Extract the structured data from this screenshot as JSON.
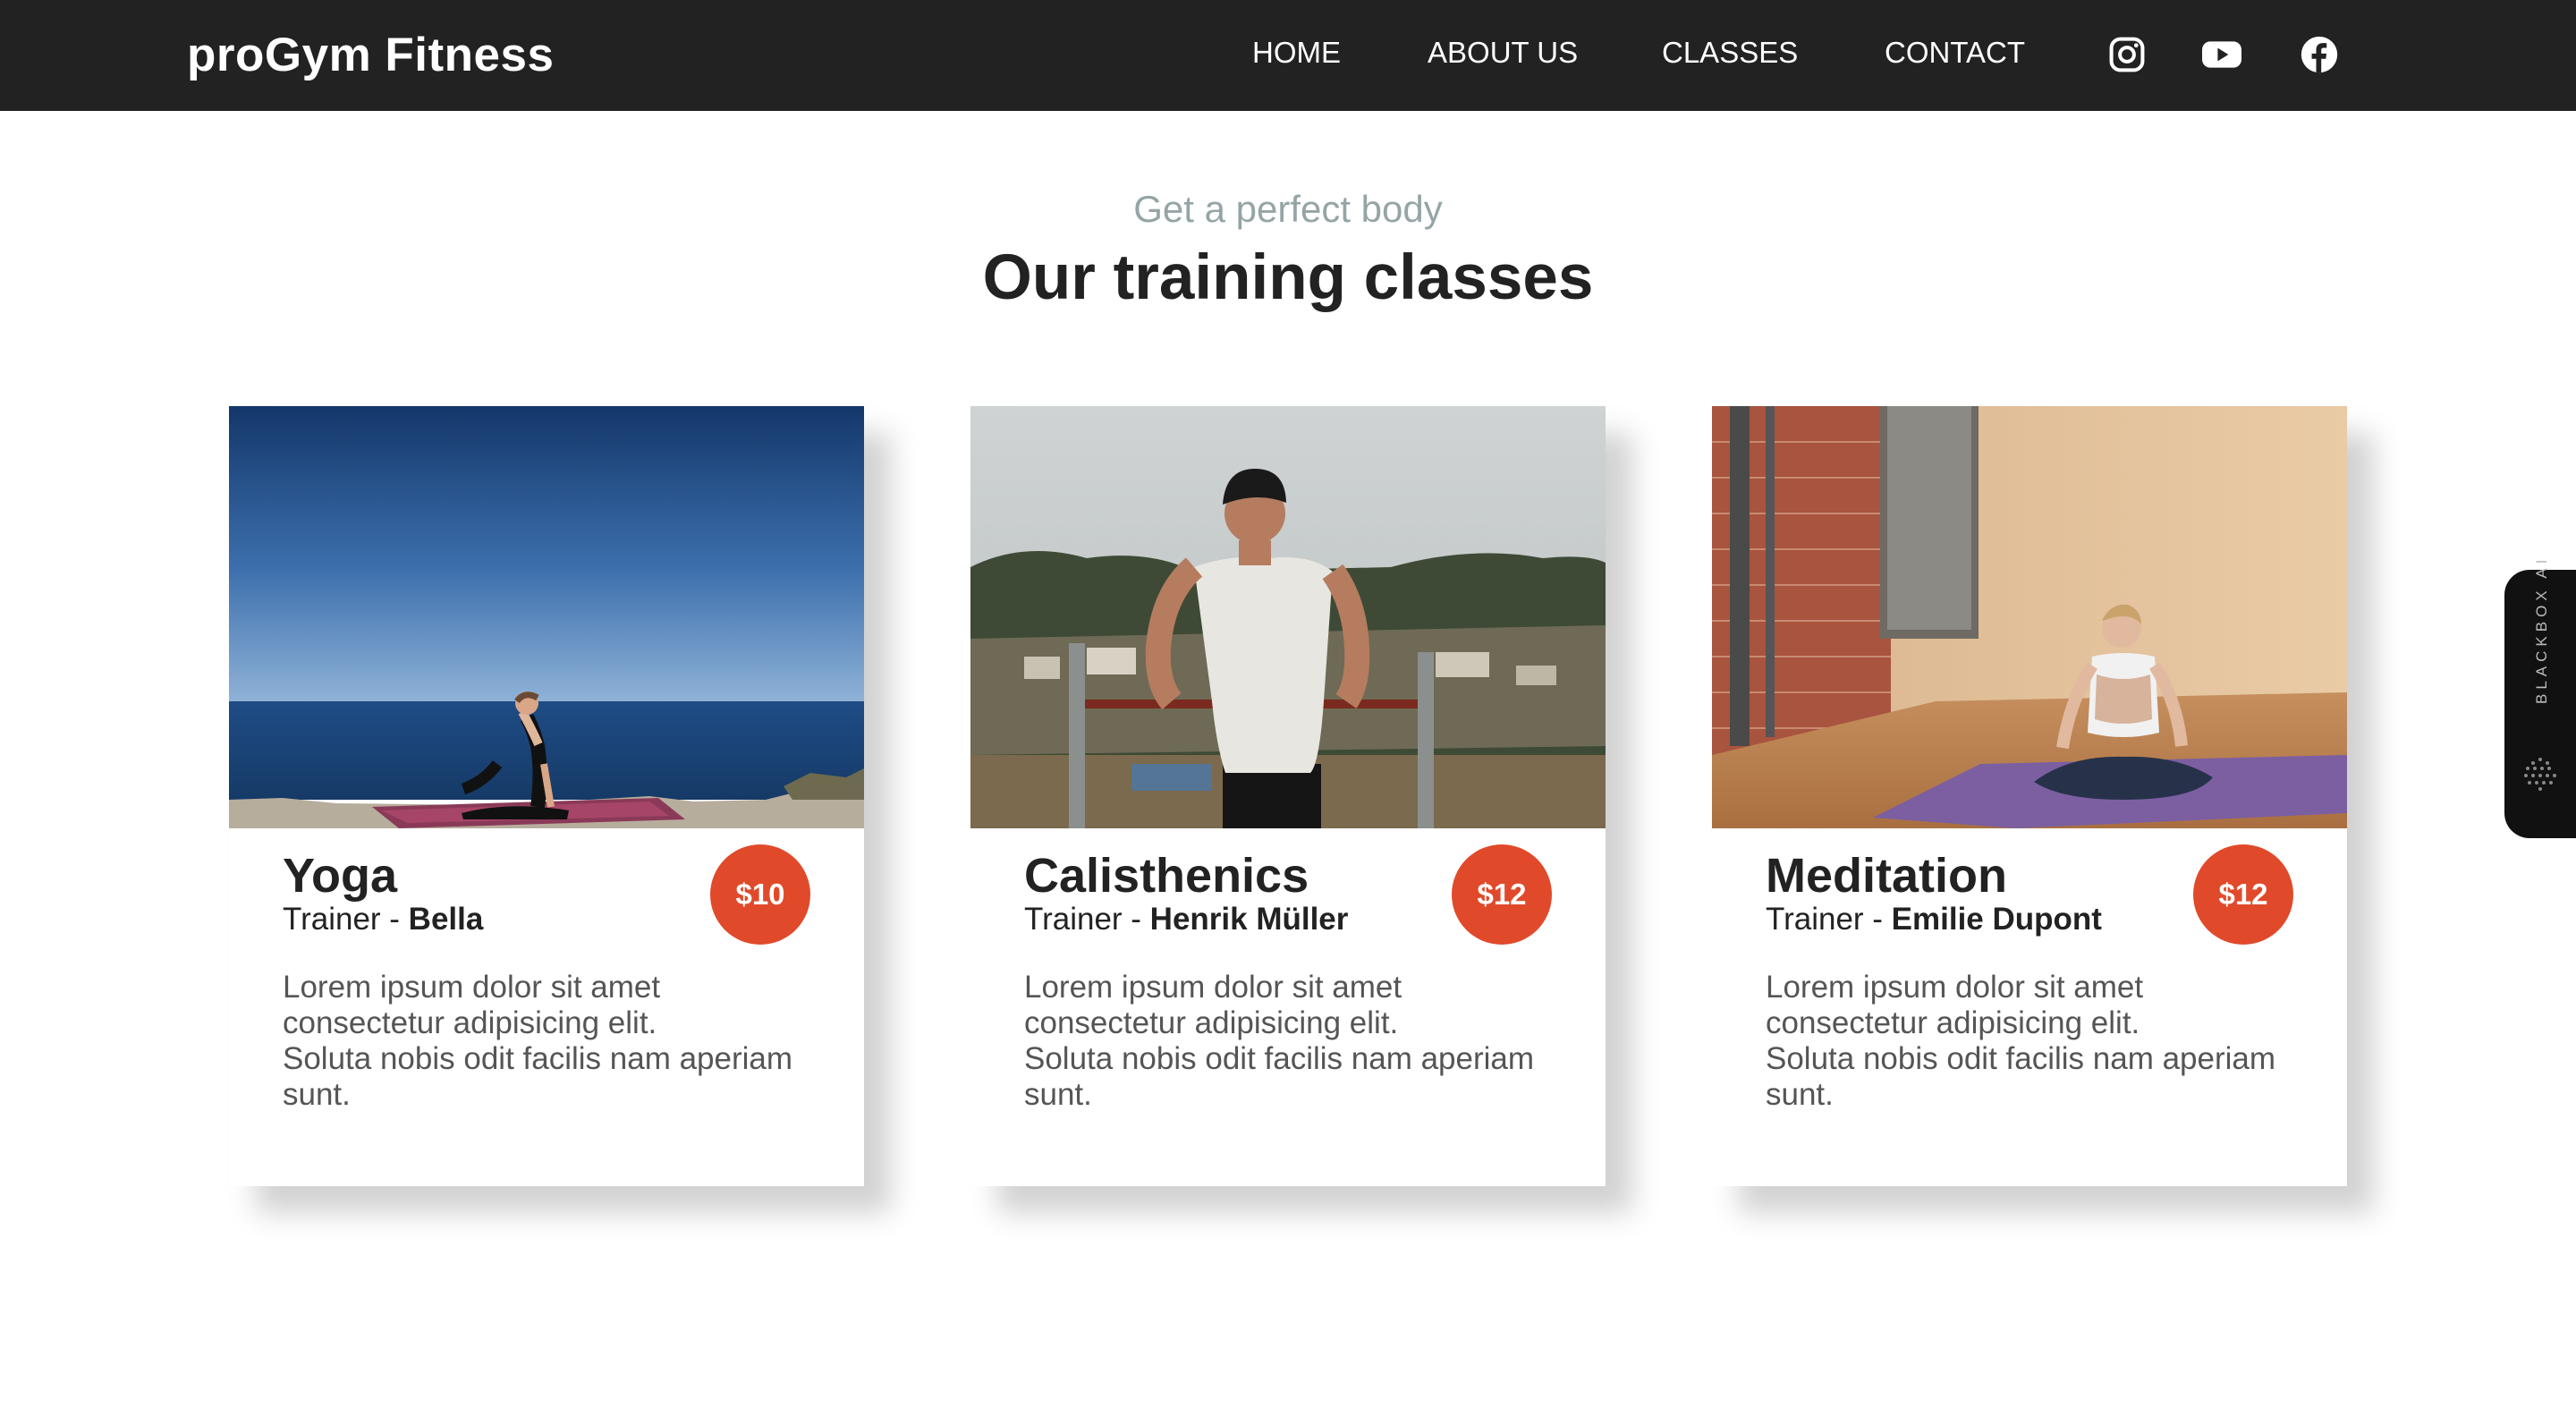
{
  "brand": "proGym Fitness",
  "nav": {
    "links": [
      "HOME",
      "ABOUT US",
      "CLASSES",
      "CONTACT"
    ],
    "social_icons": [
      "instagram-icon",
      "youtube-icon",
      "facebook-icon"
    ]
  },
  "section": {
    "subtitle": "Get a perfect body",
    "title": "Our training classes"
  },
  "classes": [
    {
      "name": "Yoga",
      "trainer_prefix": "Trainer - ",
      "trainer": "Bella",
      "price": "$10",
      "description": [
        "Lorem ipsum dolor sit amet",
        "consectetur adipisicing elit.",
        "Soluta nobis odit facilis nam aperiam",
        "sunt."
      ]
    },
    {
      "name": "Calisthenics",
      "trainer_prefix": "Trainer - ",
      "trainer": "Henrik Müller",
      "price": "$12",
      "description": [
        "Lorem ipsum dolor sit amet",
        "consectetur adipisicing elit.",
        "Soluta nobis odit facilis nam aperiam",
        "sunt."
      ]
    },
    {
      "name": "Meditation",
      "trainer_prefix": "Trainer - ",
      "trainer": "Emilie Dupont",
      "price": "$12",
      "description": [
        "Lorem ipsum dolor sit amet",
        "consectetur adipisicing elit.",
        "Soluta nobis odit facilis nam aperiam",
        "sunt."
      ]
    }
  ],
  "side_widget": {
    "label": "BLACKBOX AI"
  },
  "colors": {
    "navbar": "#222222",
    "accent": "#e04a2a",
    "subtitle": "#95a5a6"
  }
}
